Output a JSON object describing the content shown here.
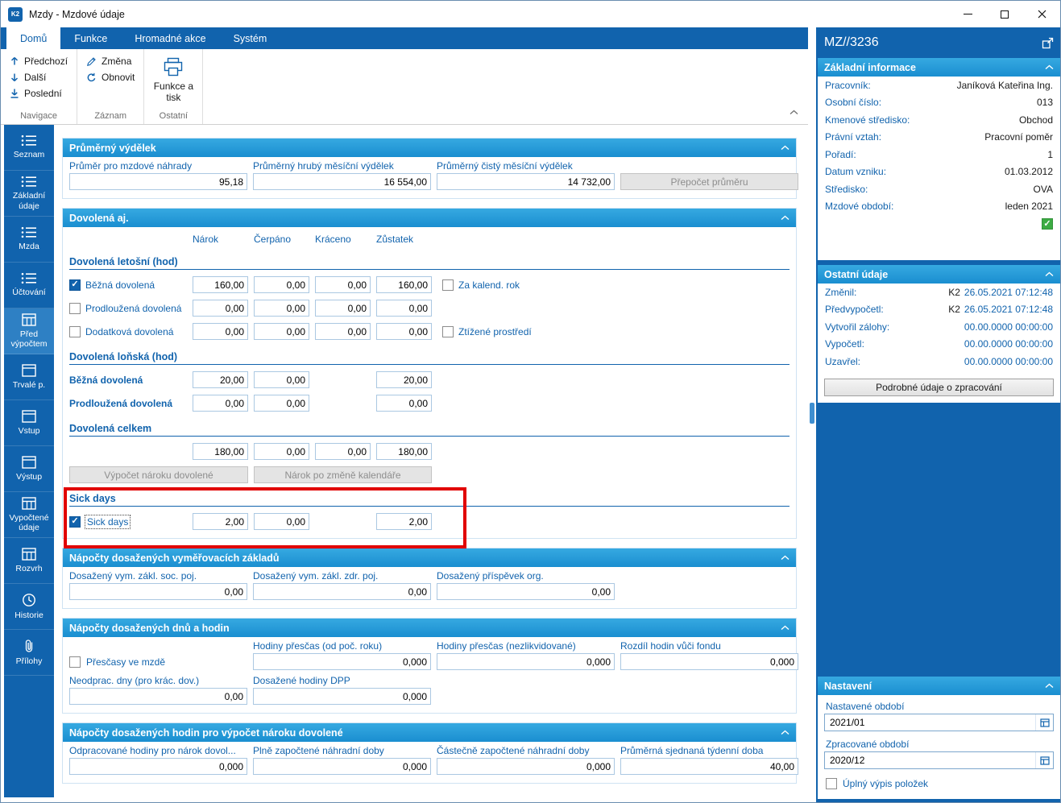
{
  "colors": {
    "accent_blue": "#1163ad",
    "section_header_top": "#36a9e1",
    "section_header_bottom": "#1a8ed0",
    "green_check": "#3cab43",
    "annotation_red": "#e10000"
  },
  "window": {
    "title": "Mzdy - Mzdové údaje"
  },
  "tabs": [
    {
      "label": "Domů",
      "active": true
    },
    {
      "label": "Funkce",
      "active": false
    },
    {
      "label": "Hromadné akce",
      "active": false
    },
    {
      "label": "Systém",
      "active": false
    }
  ],
  "ribbon": {
    "prev": "Předchozí",
    "next": "Další",
    "last": "Poslední",
    "nav_group": "Navigace",
    "change": "Změna",
    "refresh": "Obnovit",
    "record_group": "Záznam",
    "print": "Funkce a tisk",
    "other_group": "Ostatní"
  },
  "sidebar": {
    "items": [
      {
        "label": "Seznam",
        "icon": "list-icon",
        "active": false
      },
      {
        "label": "Základní údaje",
        "icon": "list-icon",
        "active": false
      },
      {
        "label": "Mzda",
        "icon": "list-icon",
        "active": false
      },
      {
        "label": "Účtování",
        "icon": "list-icon",
        "active": false
      },
      {
        "label": "Před výpočtem",
        "icon": "table-icon",
        "active": true
      },
      {
        "label": "Trvalé p.",
        "icon": "window-icon",
        "active": false
      },
      {
        "label": "Vstup",
        "icon": "window-icon",
        "active": false
      },
      {
        "label": "Výstup",
        "icon": "window-icon",
        "active": false
      },
      {
        "label": "Vypočtené údaje",
        "icon": "table-icon",
        "active": false
      },
      {
        "label": "Rozvrh",
        "icon": "table-icon",
        "active": false
      },
      {
        "label": "Historie",
        "icon": "clock-icon",
        "active": false
      },
      {
        "label": "Přílohy",
        "icon": "paperclip-icon",
        "active": false
      }
    ]
  },
  "main": {
    "average": {
      "title": "Průměrný výdělek",
      "fields": [
        {
          "label": "Průměr pro mzdové náhrady",
          "value": "95,18"
        },
        {
          "label": "Průměrný hrubý měsíční výdělek",
          "value": "16 554,00"
        },
        {
          "label": "Průměrný čistý měsíční výdělek",
          "value": "14 732,00"
        }
      ],
      "recalc_button": "Přepočet průměru"
    },
    "vacation": {
      "title": "Dovolená aj.",
      "columns": [
        "Nárok",
        "Čerpáno",
        "Kráceno",
        "Zůstatek"
      ],
      "this_year_title": "Dovolená letošní (hod)",
      "this_year_rows": [
        {
          "label": "Běžná dovolená",
          "checked": true,
          "narok": "160,00",
          "cerpano": "0,00",
          "kraceno": "0,00",
          "zustatek": "160,00",
          "extra": "Za kalend. rok",
          "extra_checked": false
        },
        {
          "label": "Prodloužená dovolená",
          "checked": false,
          "narok": "0,00",
          "cerpano": "0,00",
          "kraceno": "0,00",
          "zustatek": "0,00",
          "extra": "",
          "extra_checked": false
        },
        {
          "label": "Dodatková dovolená",
          "checked": false,
          "narok": "0,00",
          "cerpano": "0,00",
          "kraceno": "0,00",
          "zustatek": "0,00",
          "extra": "Ztížené prostředí",
          "extra_checked": false
        }
      ],
      "last_year_title": "Dovolená loňská (hod)",
      "last_year_rows": [
        {
          "label": "Běžná dovolená",
          "narok": "20,00",
          "cerpano": "0,00",
          "zustatek": "20,00"
        },
        {
          "label": "Prodloužená dovolená",
          "narok": "0,00",
          "cerpano": "0,00",
          "zustatek": "0,00"
        }
      ],
      "total_title": "Dovolená celkem",
      "total": {
        "narok": "180,00",
        "cerpano": "0,00",
        "kraceno": "0,00",
        "zustatek": "180,00"
      },
      "calc_button": "Výpočet nároku dovolené",
      "calendar_button": "Nárok po změně kalendáře",
      "sick_title": "Sick days",
      "sick": {
        "label": "Sick days",
        "checked": true,
        "narok": "2,00",
        "cerpano": "0,00",
        "zustatek": "2,00"
      }
    },
    "bases": {
      "title": "Nápočty dosažených vyměřovacích základů",
      "fields": [
        {
          "label": "Dosažený vym. zákl. soc. poj.",
          "value": "0,00"
        },
        {
          "label": "Dosažený vym. zákl. zdr. poj.",
          "value": "0,00"
        },
        {
          "label": "Dosažený příspěvek org.",
          "value": "0,00"
        }
      ]
    },
    "days_hours": {
      "title": "Nápočty dosažených dnů a hodin",
      "overtime_checkbox": "Přesčasy ve mzdě",
      "overtime_checked": false,
      "row1": [
        {
          "label": "Hodiny přesčas (od poč. roku)",
          "value": "0,000"
        },
        {
          "label": "Hodiny přesčas (nezlikvidované)",
          "value": "0,000"
        },
        {
          "label": "Rozdíl hodin vůči fondu",
          "value": "0,000"
        }
      ],
      "row2": [
        {
          "label": "Neodprac. dny (pro krác. dov.)",
          "value": "0,00"
        },
        {
          "label": "Dosažené hodiny DPP",
          "value": "0,000"
        }
      ]
    },
    "vacation_hours": {
      "title": "Nápočty dosažených hodin pro výpočet nároku dovolené",
      "fields": [
        {
          "label": "Odpracované hodiny pro nárok dovol...",
          "value": "0,000"
        },
        {
          "label": "Plně započtené náhradní doby",
          "value": "0,000"
        },
        {
          "label": "Částečně započtené náhradní doby",
          "value": "0,000"
        },
        {
          "label": "Průměrná sjednaná týdenní doba",
          "value": "40,00"
        }
      ]
    }
  },
  "right_panel": {
    "record_id": "MZ//3236",
    "basic_info": {
      "title": "Základní informace",
      "rows": [
        {
          "label": "Pracovník:",
          "value": "Janíková Kateřina Ing."
        },
        {
          "label": "Osobní číslo:",
          "value": "013"
        },
        {
          "label": "Kmenové středisko:",
          "value": "Obchod"
        },
        {
          "label": "Právní vztah:",
          "value": "Pracovní poměr"
        },
        {
          "label": "Pořadí:",
          "value": "1"
        },
        {
          "label": "Datum vzniku:",
          "value": "01.03.2012"
        },
        {
          "label": "Středisko:",
          "value": "OVA"
        },
        {
          "label": "Mzdové období:",
          "value": "leden 2021"
        }
      ],
      "status_checked": true
    },
    "other_info": {
      "title": "Ostatní údaje",
      "rows": [
        {
          "label": "Změnil:",
          "user": "K2",
          "time": "26.05.2021 07:12:48"
        },
        {
          "label": "Předvypočetl:",
          "user": "K2",
          "time": "26.05.2021 07:12:48"
        },
        {
          "label": "Vytvořil zálohy:",
          "user": "",
          "time": "00.00.0000 00:00:00"
        },
        {
          "label": "Vypočetl:",
          "user": "",
          "time": "00.00.0000 00:00:00"
        },
        {
          "label": "Uzavřel:",
          "user": "",
          "time": "00.00.0000 00:00:00"
        }
      ],
      "details_button": "Podrobné údaje o zpracování"
    },
    "settings": {
      "title": "Nastavení",
      "set_period_label": "Nastavené období",
      "set_period_value": "2021/01",
      "processed_period_label": "Zpracované období",
      "processed_period_value": "2020/12",
      "full_list_label": "Úplný výpis položek",
      "full_list_checked": false
    }
  }
}
